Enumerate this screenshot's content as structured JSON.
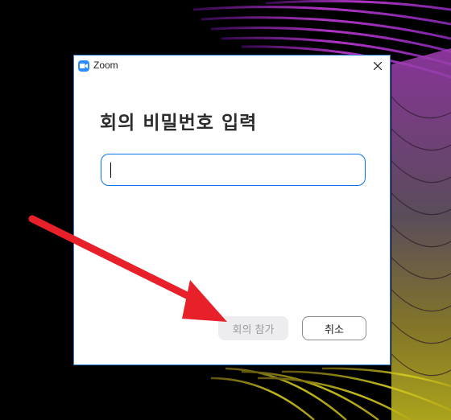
{
  "window": {
    "app_title": "Zoom",
    "app_icon": "zoom-camera-icon",
    "close_icon": "close-icon",
    "accent_color": "#0e72ed",
    "border_color": "#2a7fd4"
  },
  "dialog": {
    "heading": "회의 비밀번호 입력",
    "password_field": {
      "value": "",
      "placeholder": ""
    },
    "join_button_label": "회의 참가",
    "cancel_button_label": "취소"
  },
  "annotation": {
    "arrow_color": "#e8202a",
    "icon": "red-arrow-icon"
  }
}
